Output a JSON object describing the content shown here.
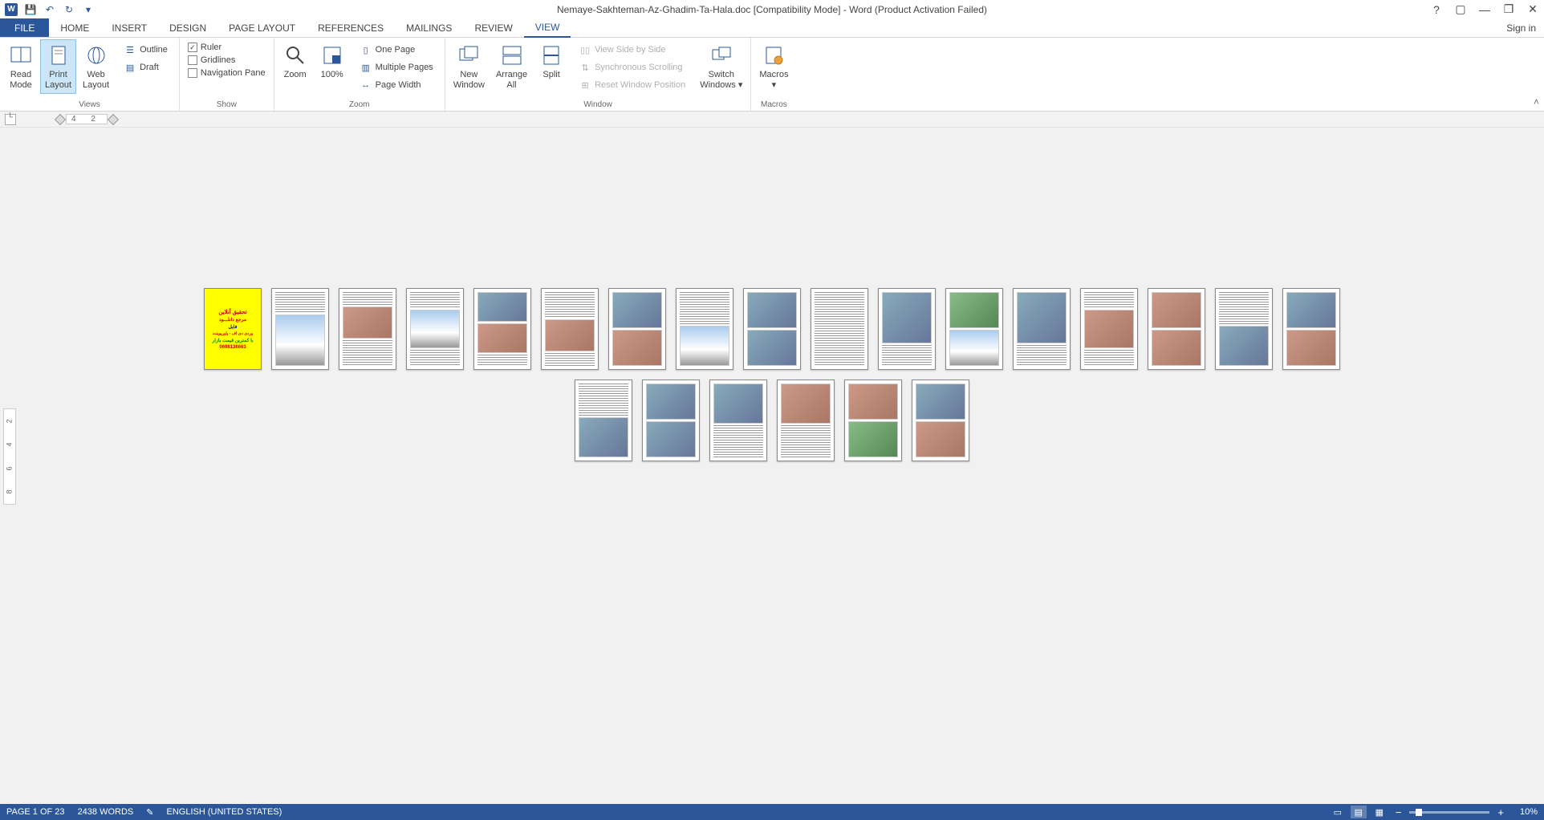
{
  "titlebar": {
    "title": "Nemaye-Sakhteman-Az-Ghadim-Ta-Hala.doc [Compatibility Mode] - Word (Product Activation Failed)"
  },
  "qat": {
    "save": "💾",
    "undo": "↶",
    "redo": "↻"
  },
  "winctrl": {
    "help": "?",
    "ribbon_opts": "▢",
    "min": "—",
    "restore": "❐",
    "close": "✕"
  },
  "tabs": {
    "file": "FILE",
    "home": "HOME",
    "insert": "INSERT",
    "design": "DESIGN",
    "page_layout": "PAGE LAYOUT",
    "references": "REFERENCES",
    "mailings": "MAILINGS",
    "review": "REVIEW",
    "view": "VIEW",
    "signin": "Sign in"
  },
  "ribbon": {
    "views": {
      "label": "Views",
      "read_mode": "Read\nMode",
      "print_layout": "Print\nLayout",
      "web_layout": "Web\nLayout",
      "outline": "Outline",
      "draft": "Draft"
    },
    "show": {
      "label": "Show",
      "ruler": "Ruler",
      "gridlines": "Gridlines",
      "nav": "Navigation Pane"
    },
    "zoom": {
      "label": "Zoom",
      "zoom": "Zoom",
      "hundred": "100%",
      "one_page": "One Page",
      "multi": "Multiple Pages",
      "page_width": "Page Width"
    },
    "window": {
      "label": "Window",
      "new_window": "New\nWindow",
      "arrange": "Arrange\nAll",
      "split": "Split",
      "side": "View Side by Side",
      "sync": "Synchronous Scrolling",
      "reset": "Reset Window Position",
      "switch": "Switch\nWindows"
    },
    "macros": {
      "label": "Macros",
      "macros": "Macros"
    }
  },
  "ruler": {
    "marks": "4  2",
    "vmarks": [
      "2",
      "4",
      "6",
      "8"
    ]
  },
  "cover": {
    "l1": "تحقیق آنلاین",
    "l2": "مرجع دانلـــود",
    "l3": "فایل",
    "l4": "وردی دی اف - پاورپوینت",
    "l5": "با کمترین قیمت بازار",
    "l6": "0698136663"
  },
  "status": {
    "page": "PAGE 1 OF 23",
    "words": "2438 WORDS",
    "lang": "ENGLISH (UNITED STATES)",
    "zoom": "10%"
  }
}
